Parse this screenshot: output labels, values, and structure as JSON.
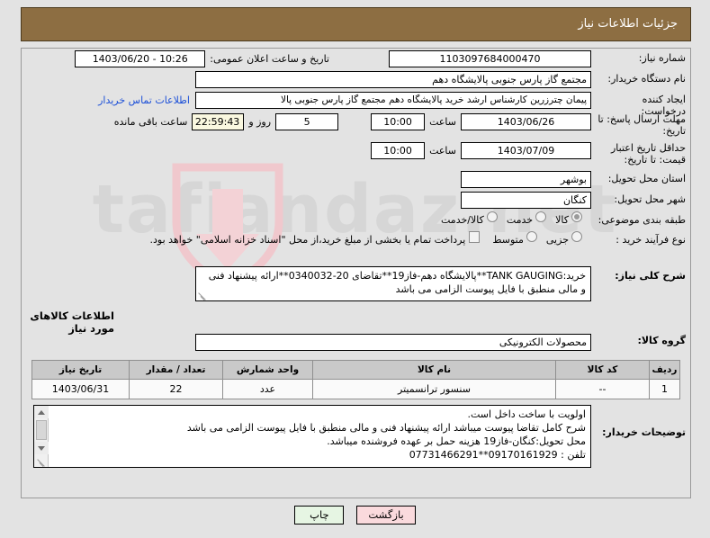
{
  "header": {
    "title": "جزئیات اطلاعات نیاز"
  },
  "watermark": {
    "text": "tafiandaz.net"
  },
  "fields": {
    "need_number": {
      "label": "شماره نیاز:",
      "value": "1103097684000470"
    },
    "public_announce": {
      "label": "تاریخ و ساعت اعلان عمومی:",
      "value": "10:26 - 1403/06/20"
    },
    "buyer_org": {
      "label": "نام دستگاه خریدار:",
      "value": "مجتمع گاز پارس جنوبی  پالایشگاه دهم"
    },
    "requester": {
      "label": "ایجاد کننده درخواست:",
      "value": "پیمان چترزرین کارشناس ارشد خرید پالایشگاه دهم مجتمع گاز پارس جنوبی  پالا",
      "contact_link": "اطلاعات تماس خریدار"
    },
    "response_deadline": {
      "label": "مهلت ارسال پاسخ: تا تاریخ:",
      "date": "1403/06/26",
      "time_label": "ساعت",
      "time": "10:00",
      "days": "5",
      "days_sep": "روز و",
      "countdown": "22:59:43",
      "remaining_label": "ساعت باقی مانده"
    },
    "price_validity": {
      "label": "حداقل تاریخ اعتبار قیمت: تا تاریخ:",
      "date": "1403/07/09",
      "time_label": "ساعت",
      "time": "10:00"
    },
    "province": {
      "label": "استان محل تحویل:",
      "value": "بوشهر"
    },
    "city": {
      "label": "شهر محل تحویل:",
      "value": "کنگان"
    },
    "classification": {
      "label": "طبقه بندی موضوعی:",
      "options": [
        {
          "text": "کالا",
          "selected": true
        },
        {
          "text": "خدمت",
          "selected": false
        },
        {
          "text": "کالا/خدمت",
          "selected": false
        }
      ]
    },
    "process_type": {
      "label": "نوع فرآیند خرید :",
      "options": [
        {
          "text": "جزیی",
          "selected": false
        },
        {
          "text": "متوسط",
          "selected": false
        }
      ],
      "checkbox": {
        "text": "پرداخت تمام یا بخشی از مبلغ خرید،از محل \"اسناد خزانه اسلامی\" خواهد بود.",
        "checked": false
      }
    },
    "general_description": {
      "label": "شرح کلی نیاز:",
      "value": "خرید:TANK GAUGING**پالایشگاه دهم-فاز19**تقاضای 20-0340032**ارائه پیشنهاد فنی و مالی منطبق با فایل پیوست الزامی می باشد"
    },
    "goods_section_title": "اطلاعات کالاهای مورد نیاز",
    "goods_group": {
      "label": "گروه کالا:",
      "value": "محصولات الکترونیکی"
    },
    "buyer_notes": {
      "label": "توضیحات خریدار:",
      "lines": [
        "اولویت با ساخت داخل است.",
        "شرح کامل تقاضا پیوست میباشد ارائه پیشنهاد فنی و مالی منطبق با فایل پیوست الزامی می باشد",
        "محل تحویل:کنگان-فاز19 هزینه حمل بر عهده فروشنده میباشد.",
        "تلفن : 09170161929**07731466291"
      ]
    }
  },
  "goods_table": {
    "columns": [
      "ردیف",
      "کد کالا",
      "نام کالا",
      "واحد شمارش",
      "تعداد / مقدار",
      "تاریخ نیاز"
    ],
    "rows": [
      {
        "row_no": "1",
        "code": "--",
        "name": "سنسور ترانسمیتر",
        "unit": "عدد",
        "qty": "22",
        "need_date": "1403/06/31"
      }
    ]
  },
  "buttons": {
    "print": "چاپ",
    "back": "بازگشت"
  },
  "colors": {
    "header_bg": "#8d6e42",
    "link": "#1b4fd8",
    "print_btn": "#e6f5e3",
    "back_btn": "#fadadd",
    "countdown_bg": "#faf8e0"
  }
}
